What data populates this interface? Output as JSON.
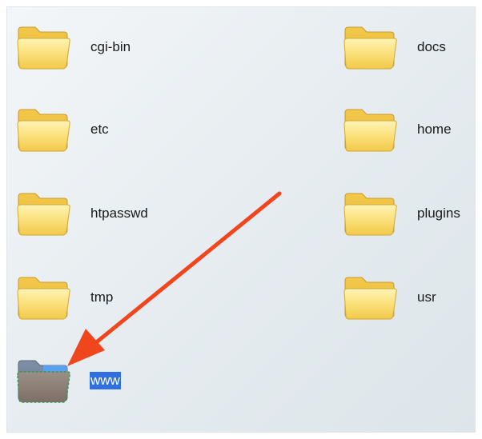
{
  "folders": [
    {
      "name": "cgi-bin",
      "icon": "folder-icon",
      "selected": false
    },
    {
      "name": "docs",
      "icon": "folder-icon",
      "selected": false
    },
    {
      "name": "etc",
      "icon": "folder-icon",
      "selected": false
    },
    {
      "name": "home",
      "icon": "folder-icon",
      "selected": false
    },
    {
      "name": "htpasswd",
      "icon": "folder-icon",
      "selected": false
    },
    {
      "name": "plugins",
      "icon": "folder-icon",
      "selected": false
    },
    {
      "name": "tmp",
      "icon": "folder-icon",
      "selected": false
    },
    {
      "name": "usr",
      "icon": "folder-icon",
      "selected": false
    },
    {
      "name": "www",
      "icon": "folder-icon",
      "selected": true
    }
  ],
  "colors": {
    "folder_yellow": "#f7d55a",
    "selection_blue": "#2f6fe0",
    "arrow_red": "#f0461e"
  },
  "annotation": {
    "icon": "pointer-arrow",
    "target": "www"
  }
}
